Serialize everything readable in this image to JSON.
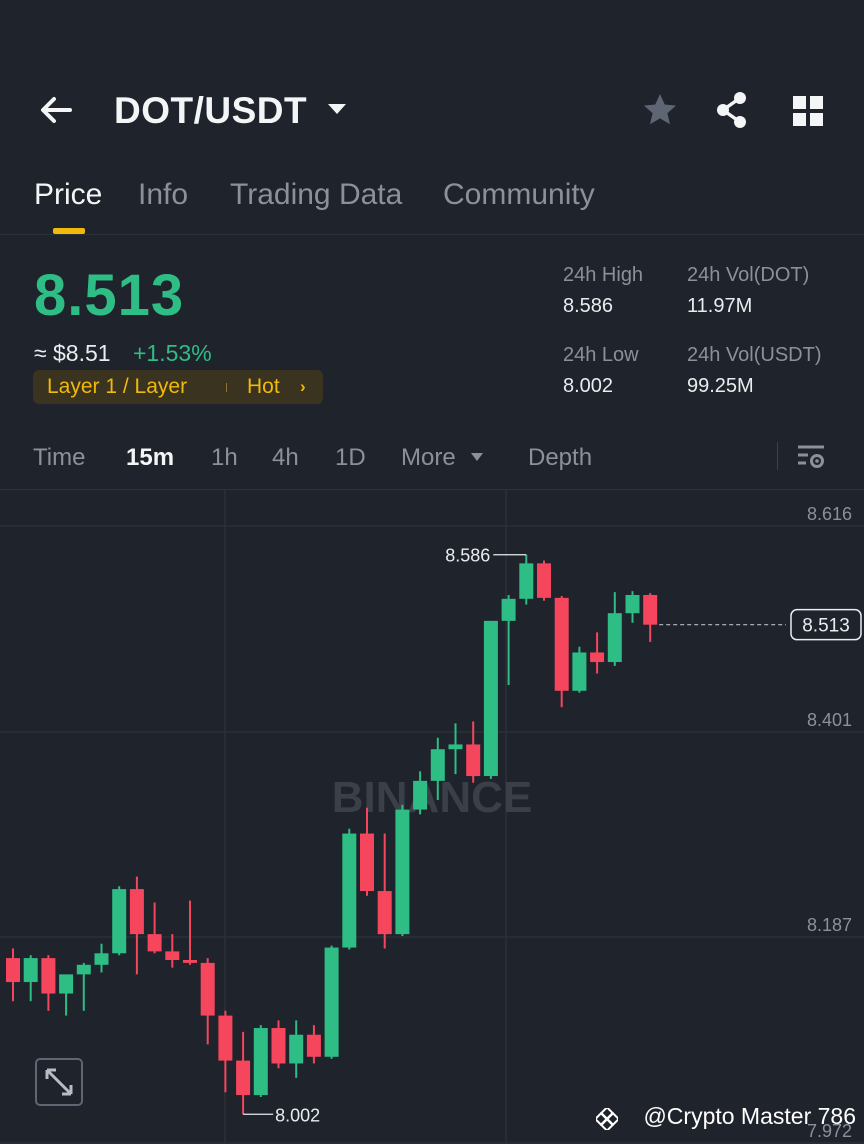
{
  "header": {
    "pair": "DOT/USDT",
    "icons": [
      "back-arrow-icon",
      "caret-down-icon",
      "star-icon",
      "share-icon",
      "grid-icon"
    ]
  },
  "tabs": [
    {
      "label": "Price",
      "active": true
    },
    {
      "label": "Info",
      "active": false
    },
    {
      "label": "Trading Data",
      "active": false
    },
    {
      "label": "Community",
      "active": false
    }
  ],
  "price": {
    "last": "8.513",
    "usd": "≈ $8.51",
    "change": "+1.53%",
    "tag": "Layer 1 / Layer",
    "hot": "Hot",
    "hot_arrow": "›"
  },
  "stats": {
    "high_label": "24h High",
    "high": "8.586",
    "low_label": "24h Low",
    "low": "8.002",
    "vol_dot_label": "24h Vol(DOT)",
    "vol_dot": "11.97M",
    "vol_usdt_label": "24h Vol(USDT)",
    "vol_usdt": "99.25M"
  },
  "timeframes": [
    {
      "label": "Time",
      "active": false
    },
    {
      "label": "15m",
      "active": true
    },
    {
      "label": "1h",
      "active": false
    },
    {
      "label": "4h",
      "active": false
    },
    {
      "label": "1D",
      "active": false
    },
    {
      "label": "More",
      "active": false
    },
    {
      "label": "Depth",
      "active": false
    }
  ],
  "colors": {
    "up": "#2ebd85",
    "down": "#f6465d",
    "accent": "#f0b90b",
    "bg": "#1f232b"
  },
  "chart_data": {
    "type": "candlestick",
    "y_ticks": [
      "8.616",
      "8.401",
      "8.187",
      "7.972"
    ],
    "ylim": [
      7.972,
      8.616
    ],
    "current_price_label": "8.513",
    "high_marker": "8.586",
    "low_marker": "8.002",
    "watermark": "BINANCE",
    "grid": true,
    "candles": [
      {
        "o": 8.165,
        "h": 8.175,
        "l": 8.12,
        "c": 8.14
      },
      {
        "o": 8.14,
        "h": 8.168,
        "l": 8.12,
        "c": 8.165
      },
      {
        "o": 8.165,
        "h": 8.168,
        "l": 8.11,
        "c": 8.128
      },
      {
        "o": 8.128,
        "h": 8.148,
        "l": 8.105,
        "c": 8.148
      },
      {
        "o": 8.148,
        "h": 8.16,
        "l": 8.11,
        "c": 8.158
      },
      {
        "o": 8.158,
        "h": 8.18,
        "l": 8.15,
        "c": 8.17
      },
      {
        "o": 8.17,
        "h": 8.24,
        "l": 8.168,
        "c": 8.237
      },
      {
        "o": 8.237,
        "h": 8.25,
        "l": 8.148,
        "c": 8.19
      },
      {
        "o": 8.19,
        "h": 8.223,
        "l": 8.17,
        "c": 8.172
      },
      {
        "o": 8.172,
        "h": 8.19,
        "l": 8.155,
        "c": 8.163
      },
      {
        "o": 8.163,
        "h": 8.225,
        "l": 8.158,
        "c": 8.16
      },
      {
        "o": 8.16,
        "h": 8.165,
        "l": 8.075,
        "c": 8.105
      },
      {
        "o": 8.105,
        "h": 8.11,
        "l": 8.025,
        "c": 8.058
      },
      {
        "o": 8.058,
        "h": 8.088,
        "l": 8.002,
        "c": 8.022
      },
      {
        "o": 8.022,
        "h": 8.095,
        "l": 8.02,
        "c": 8.092
      },
      {
        "o": 8.092,
        "h": 8.1,
        "l": 8.05,
        "c": 8.055
      },
      {
        "o": 8.055,
        "h": 8.1,
        "l": 8.04,
        "c": 8.085
      },
      {
        "o": 8.085,
        "h": 8.095,
        "l": 8.055,
        "c": 8.062
      },
      {
        "o": 8.062,
        "h": 8.178,
        "l": 8.06,
        "c": 8.176
      },
      {
        "o": 8.176,
        "h": 8.3,
        "l": 8.174,
        "c": 8.295
      },
      {
        "o": 8.295,
        "h": 8.322,
        "l": 8.23,
        "c": 8.235
      },
      {
        "o": 8.235,
        "h": 8.295,
        "l": 8.175,
        "c": 8.19
      },
      {
        "o": 8.19,
        "h": 8.325,
        "l": 8.188,
        "c": 8.32
      },
      {
        "o": 8.32,
        "h": 8.36,
        "l": 8.315,
        "c": 8.35
      },
      {
        "o": 8.35,
        "h": 8.395,
        "l": 8.33,
        "c": 8.383
      },
      {
        "o": 8.383,
        "h": 8.41,
        "l": 8.357,
        "c": 8.388
      },
      {
        "o": 8.388,
        "h": 8.412,
        "l": 8.348,
        "c": 8.355
      },
      {
        "o": 8.355,
        "h": 8.517,
        "l": 8.352,
        "c": 8.517
      },
      {
        "o": 8.517,
        "h": 8.544,
        "l": 8.45,
        "c": 8.54
      },
      {
        "o": 8.54,
        "h": 8.586,
        "l": 8.534,
        "c": 8.577
      },
      {
        "o": 8.577,
        "h": 8.58,
        "l": 8.538,
        "c": 8.541
      },
      {
        "o": 8.541,
        "h": 8.543,
        "l": 8.427,
        "c": 8.444
      },
      {
        "o": 8.444,
        "h": 8.49,
        "l": 8.442,
        "c": 8.484
      },
      {
        "o": 8.484,
        "h": 8.505,
        "l": 8.462,
        "c": 8.474
      },
      {
        "o": 8.474,
        "h": 8.547,
        "l": 8.47,
        "c": 8.525
      },
      {
        "o": 8.525,
        "h": 8.548,
        "l": 8.515,
        "c": 8.544
      },
      {
        "o": 8.544,
        "h": 8.546,
        "l": 8.495,
        "c": 8.513
      }
    ]
  },
  "credit": "@Crypto Master 786"
}
